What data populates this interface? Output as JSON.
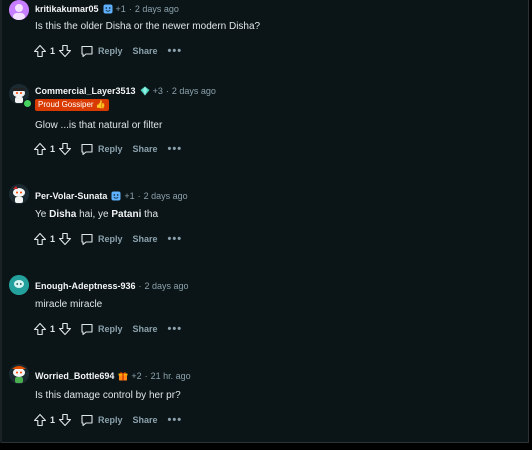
{
  "colors": {
    "background": "#0b1416",
    "text": "#dfe5e8",
    "meta": "#8ba2ad",
    "flair_bg": "#d93a00",
    "online": "#46d160"
  },
  "actions": {
    "reply_label": "Reply",
    "share_label": "Share",
    "more_label": "•••"
  },
  "comments": [
    {
      "username": "kritikakumar05",
      "karma": "+1",
      "time": "2 days ago",
      "separator": "·",
      "body": "Is this the older Disha or the newer modern Disha?",
      "votes": "1",
      "avatar_color": "#c77dff",
      "badge": "smile-badge-icon"
    },
    {
      "username": "Commercial_Layer3513",
      "karma": "+3",
      "time": "2 days ago",
      "separator": "·",
      "flair": "Proud Gossiper 👍",
      "body": "Glow ...is that natural or filter",
      "votes": "1",
      "avatar_color": "#e8e8e8",
      "badge": "diamond-badge-icon"
    },
    {
      "username": "Per-Volar-Sunata",
      "karma": "+1",
      "time": "2 days ago",
      "separator": "·",
      "body_parts": [
        "Ye ",
        "Disha",
        " hai, ye ",
        "Patani",
        " tha"
      ],
      "votes": "1",
      "avatar_color": "#f0f0f0",
      "badge": "smile-badge-icon"
    },
    {
      "username": "Enough-Adeptness-936",
      "time": "2 days ago",
      "separator": "·",
      "body": "miracle miracle",
      "votes": "1",
      "avatar_color": "#24a19c"
    },
    {
      "username": "Worried_Bottle694",
      "karma": "+2",
      "time": "21 hr. ago",
      "separator": "·",
      "body": "Is this damage control by her pr?",
      "votes": "1",
      "avatar_color": "#e8e8e8",
      "badge": "gift-badge-icon"
    }
  ]
}
